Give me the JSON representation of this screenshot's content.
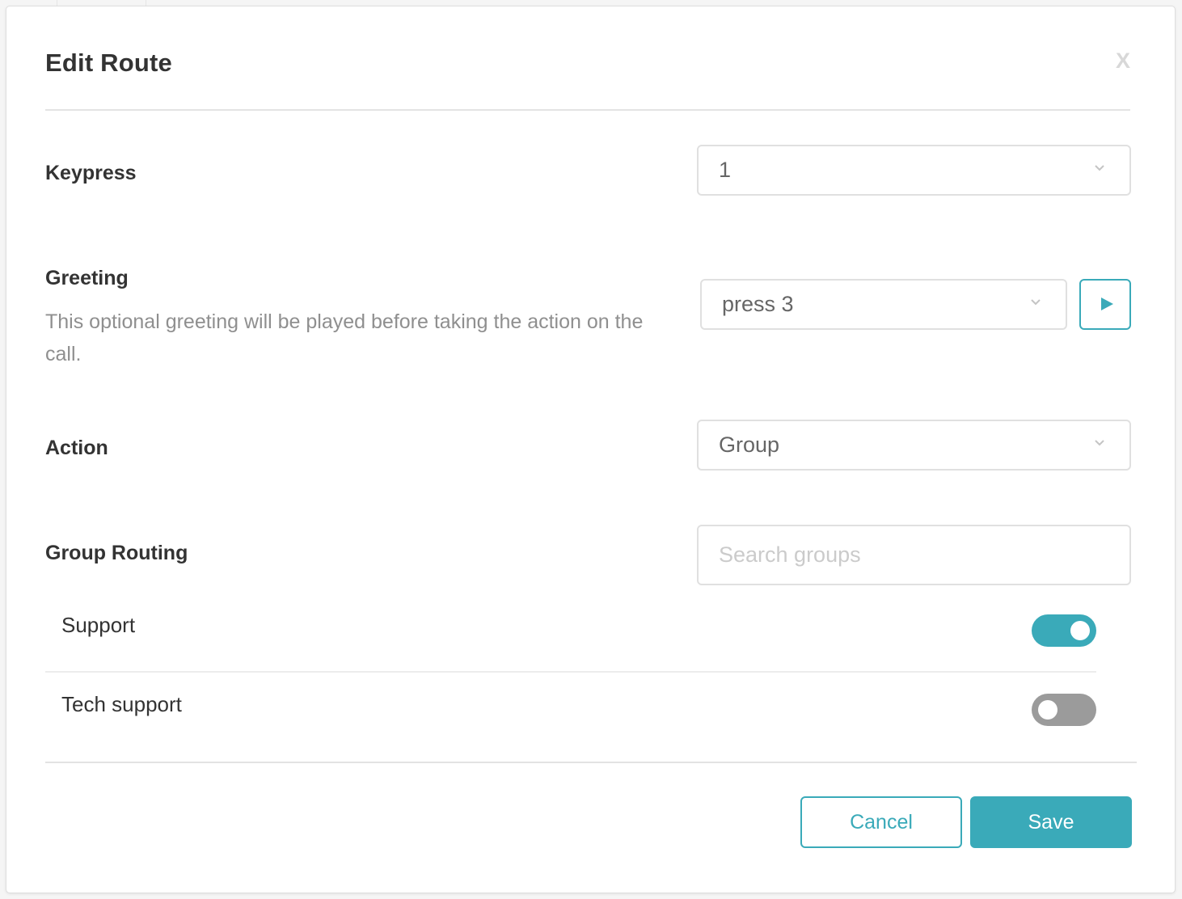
{
  "modal": {
    "title": "Edit Route",
    "close_label": "X"
  },
  "keypress": {
    "label": "Keypress",
    "value": "1"
  },
  "greeting": {
    "label": "Greeting",
    "description": "This optional greeting will be played before taking the action on the call.",
    "value": "press 3",
    "play_icon": "play-icon"
  },
  "action": {
    "label": "Action",
    "value": "Group"
  },
  "group_routing": {
    "label": "Group Routing",
    "search_placeholder": "Search groups",
    "search_value": "",
    "groups": [
      {
        "name": "Support",
        "enabled": true
      },
      {
        "name": "Tech support",
        "enabled": false
      }
    ]
  },
  "footer": {
    "cancel_label": "Cancel",
    "save_label": "Save"
  },
  "colors": {
    "accent": "#3aaab9",
    "toggle_off": "#9b9b9b",
    "label": "#333333",
    "muted": "#8f8f8f",
    "border": "#e0e0e0"
  }
}
